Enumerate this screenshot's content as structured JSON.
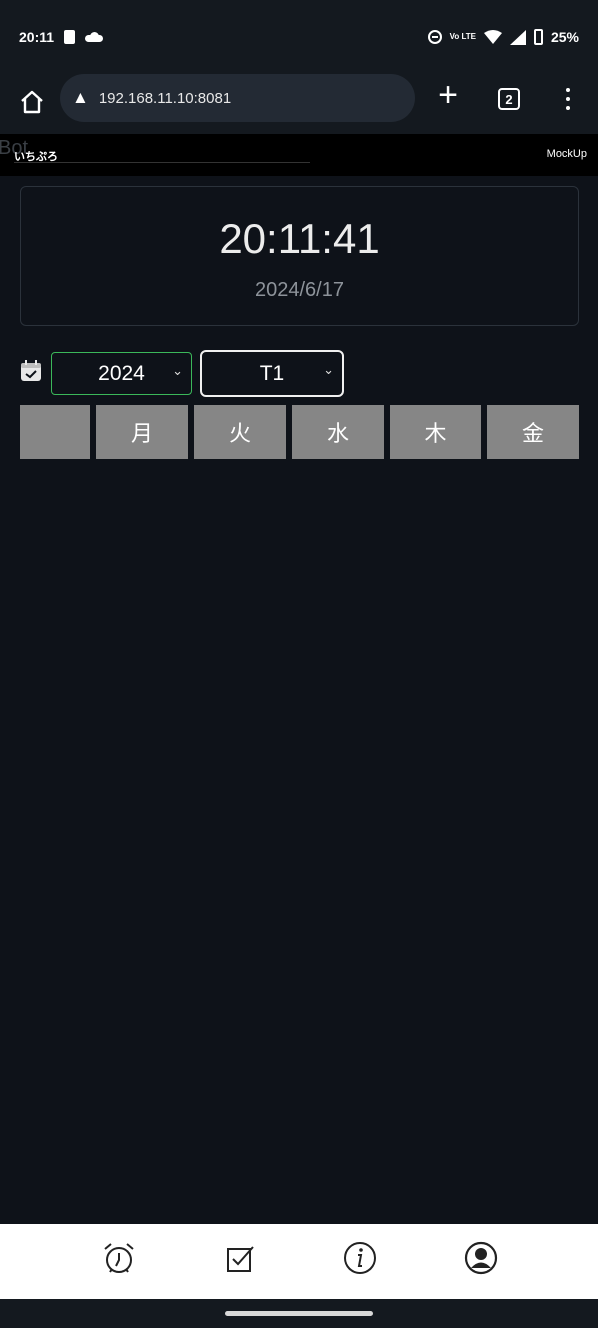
{
  "status_bar": {
    "time": "20:11",
    "lte": "Vo LTE",
    "battery": "25%"
  },
  "browser": {
    "url": "192.168.11.10:8081",
    "tab_count": "2"
  },
  "page_header": {
    "brand_ghost": "Bot",
    "brand": "いちぷろ",
    "right_label": "MockUp"
  },
  "clock": {
    "time": "20:11:41",
    "date": "2024/6/17"
  },
  "filters": {
    "year": "2024",
    "term": "T1"
  },
  "weekdays": [
    "",
    "月",
    "火",
    "水",
    "木",
    "金"
  ],
  "colors": {
    "background": "#0e1219",
    "day_button": "#868686",
    "year_border": "#3bb85a",
    "bottom_nav": "#ffffff"
  },
  "bottom_nav": {
    "items": [
      "alarm-clock-icon",
      "checkbox-icon",
      "info-icon",
      "account-icon"
    ]
  }
}
